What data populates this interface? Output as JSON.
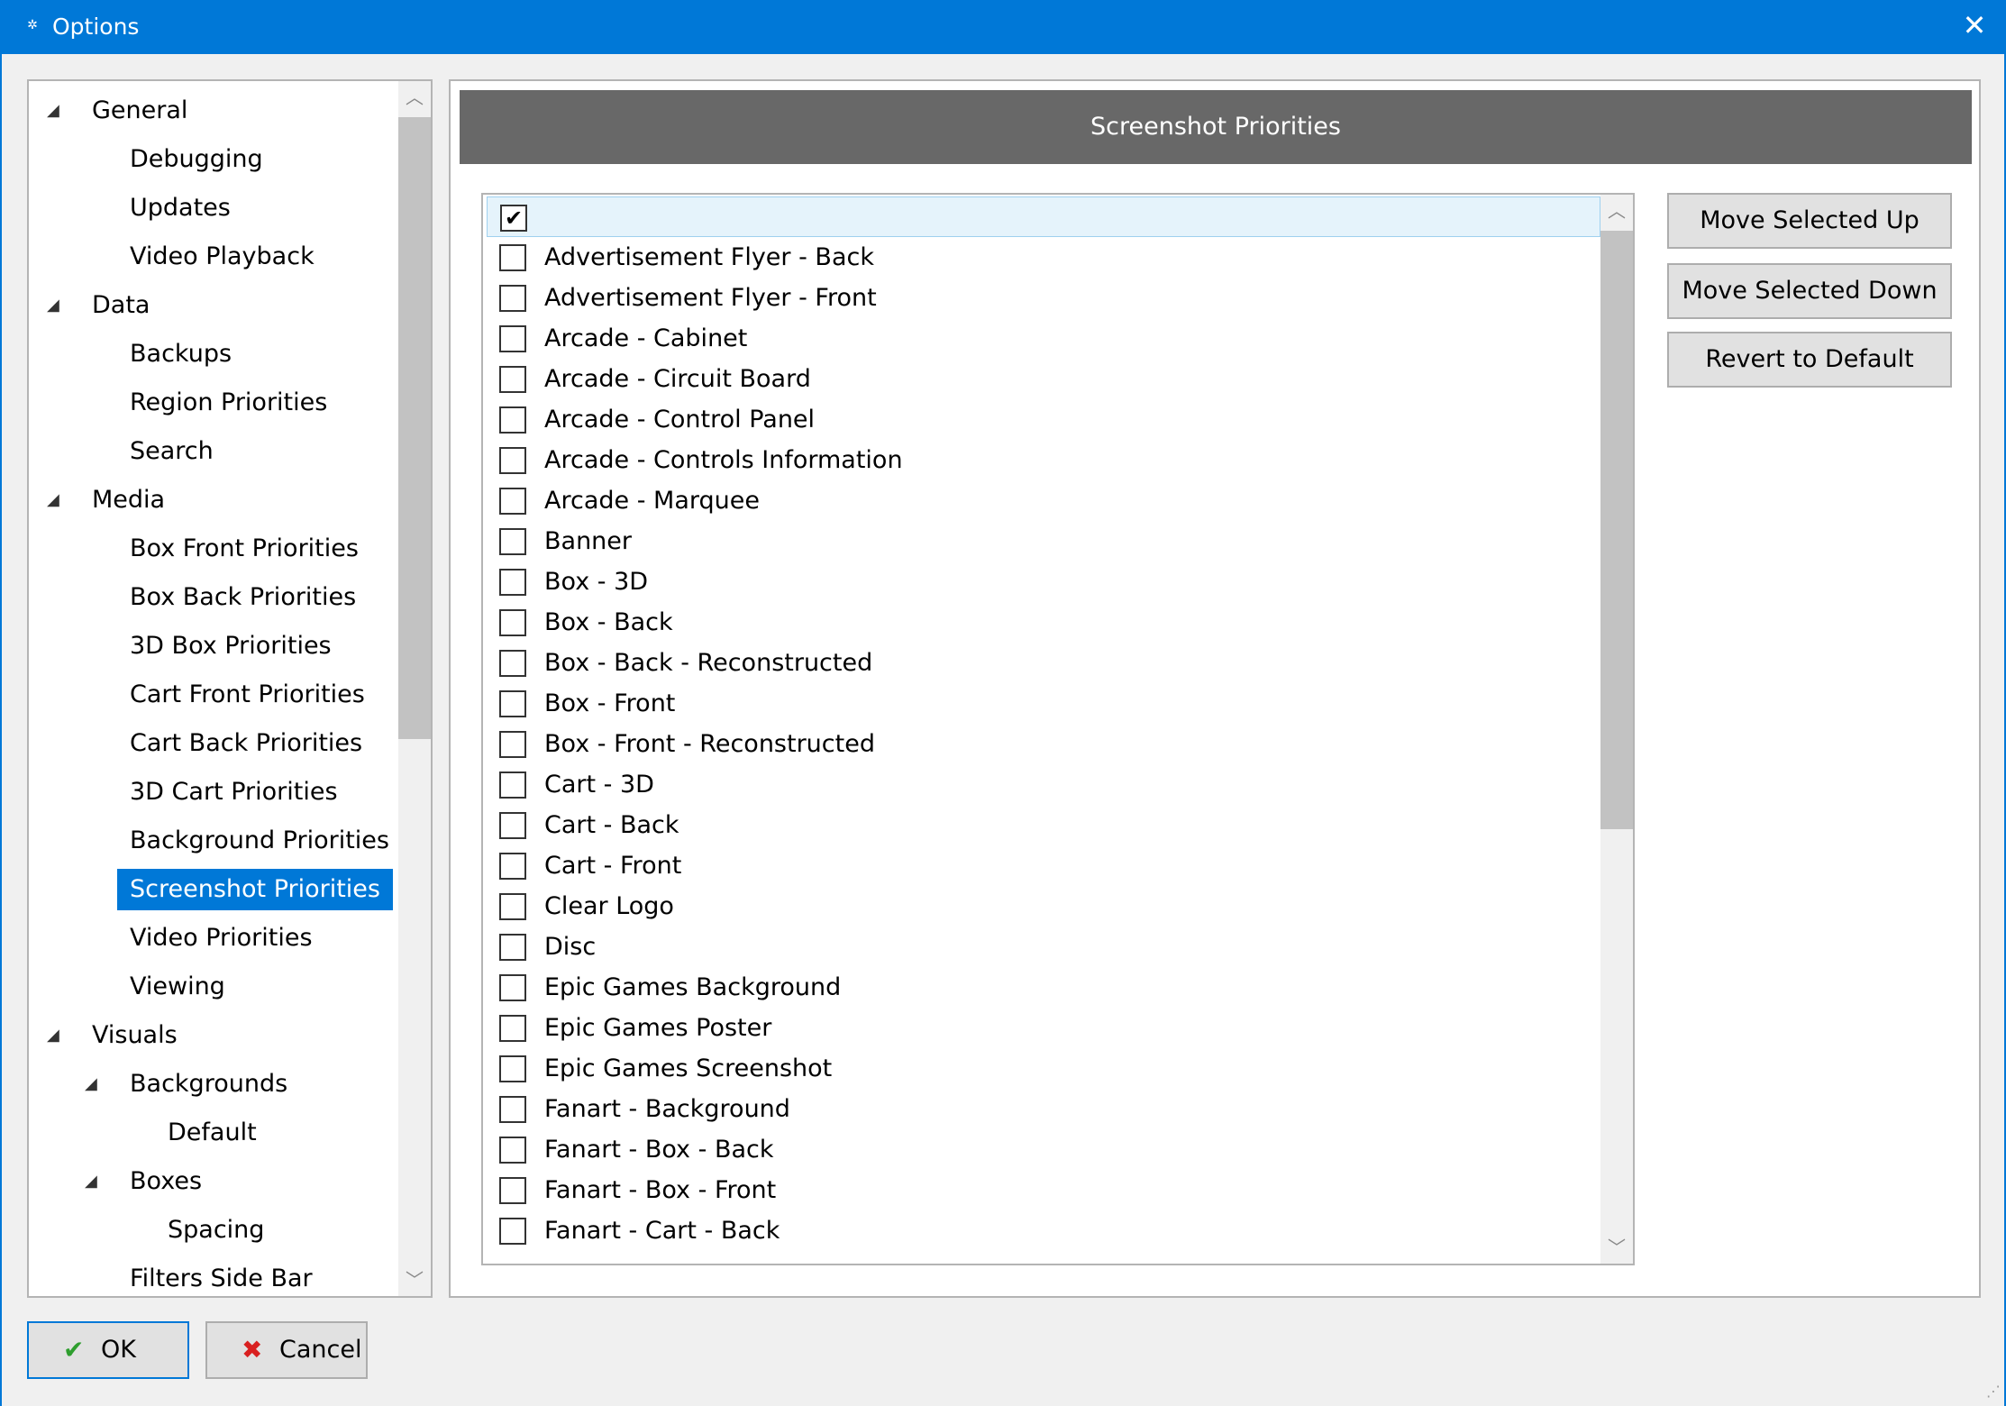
{
  "window": {
    "title": "Options",
    "close_glyph": "✕",
    "icon": "gear-icon"
  },
  "tree": {
    "items": [
      {
        "label": "General",
        "level": 0,
        "expander": "◢"
      },
      {
        "label": "Debugging",
        "level": 1
      },
      {
        "label": "Updates",
        "level": 1
      },
      {
        "label": "Video Playback",
        "level": 1
      },
      {
        "label": "Data",
        "level": 0,
        "expander": "◢"
      },
      {
        "label": "Backups",
        "level": 1
      },
      {
        "label": "Region Priorities",
        "level": 1
      },
      {
        "label": "Search",
        "level": 1
      },
      {
        "label": "Media",
        "level": 0,
        "expander": "◢"
      },
      {
        "label": "Box Front Priorities",
        "level": 1
      },
      {
        "label": "Box Back Priorities",
        "level": 1
      },
      {
        "label": "3D Box Priorities",
        "level": 1
      },
      {
        "label": "Cart Front Priorities",
        "level": 1
      },
      {
        "label": "Cart Back Priorities",
        "level": 1
      },
      {
        "label": "3D Cart Priorities",
        "level": 1
      },
      {
        "label": "Background Priorities",
        "level": 1
      },
      {
        "label": "Screenshot Priorities",
        "level": 1,
        "selected": true
      },
      {
        "label": "Video Priorities",
        "level": 1
      },
      {
        "label": "Viewing",
        "level": 1
      },
      {
        "label": "Visuals",
        "level": 0,
        "expander": "◢"
      },
      {
        "label": "Backgrounds",
        "level": 1,
        "expander": "◢"
      },
      {
        "label": "Default",
        "level": 2
      },
      {
        "label": "Boxes",
        "level": 1,
        "expander": "◢"
      },
      {
        "label": "Spacing",
        "level": 2
      },
      {
        "label": "Filters Side Bar",
        "level": 1
      }
    ]
  },
  "panel": {
    "header": "Screenshot Priorities",
    "list": [
      {
        "label": "",
        "checked": true,
        "highlighted": true
      },
      {
        "label": "Advertisement Flyer - Back",
        "checked": false
      },
      {
        "label": "Advertisement Flyer - Front",
        "checked": false
      },
      {
        "label": "Arcade - Cabinet",
        "checked": false
      },
      {
        "label": "Arcade - Circuit Board",
        "checked": false
      },
      {
        "label": "Arcade - Control Panel",
        "checked": false
      },
      {
        "label": "Arcade - Controls Information",
        "checked": false
      },
      {
        "label": "Arcade - Marquee",
        "checked": false
      },
      {
        "label": "Banner",
        "checked": false
      },
      {
        "label": "Box - 3D",
        "checked": false
      },
      {
        "label": "Box - Back",
        "checked": false
      },
      {
        "label": "Box - Back - Reconstructed",
        "checked": false
      },
      {
        "label": "Box - Front",
        "checked": false
      },
      {
        "label": "Box - Front - Reconstructed",
        "checked": false
      },
      {
        "label": "Cart - 3D",
        "checked": false
      },
      {
        "label": "Cart - Back",
        "checked": false
      },
      {
        "label": "Cart - Front",
        "checked": false
      },
      {
        "label": "Clear Logo",
        "checked": false
      },
      {
        "label": "Disc",
        "checked": false
      },
      {
        "label": "Epic Games Background",
        "checked": false
      },
      {
        "label": "Epic Games Poster",
        "checked": false
      },
      {
        "label": "Epic Games Screenshot",
        "checked": false
      },
      {
        "label": "Fanart - Background",
        "checked": false
      },
      {
        "label": "Fanart - Box - Back",
        "checked": false
      },
      {
        "label": "Fanart - Box - Front",
        "checked": false
      },
      {
        "label": "Fanart - Cart - Back",
        "checked": false
      }
    ],
    "buttons": {
      "move_up": "Move Selected Up",
      "move_down": "Move Selected Down",
      "revert": "Revert to Default"
    }
  },
  "footer": {
    "ok_label": "OK",
    "cancel_label": "Cancel",
    "ok_icon": "checkmark-icon",
    "cancel_icon": "x-icon",
    "ok_color": "#2e9e2e",
    "cancel_color": "#d92020"
  },
  "colors": {
    "accent": "#0078d7",
    "header_bar": "#686868",
    "selection": "#0078d7"
  }
}
